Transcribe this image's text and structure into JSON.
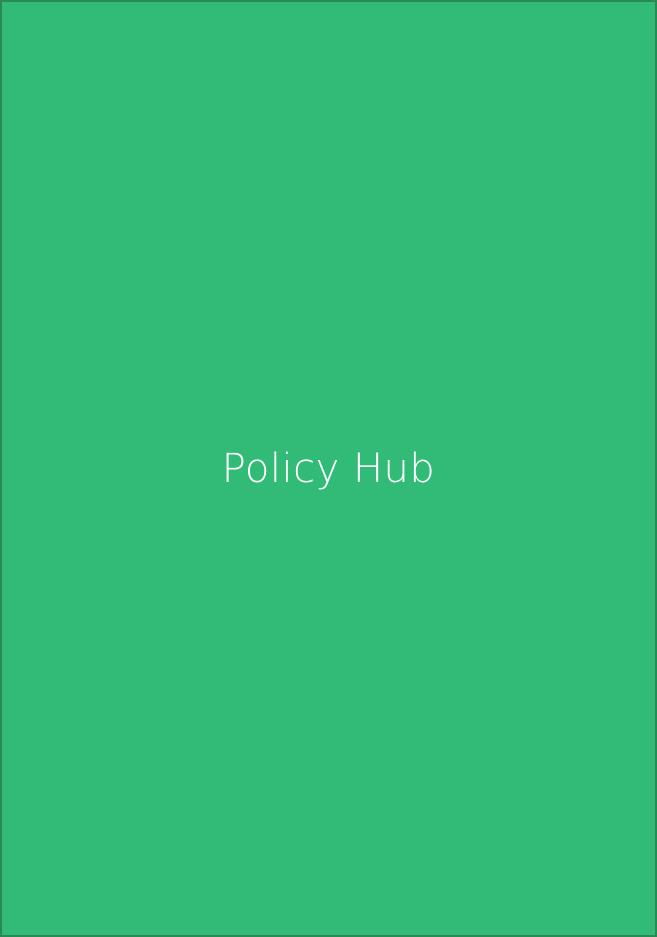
{
  "app": {
    "title": "Policy Hub"
  },
  "colors": {
    "background": "#32bb77",
    "border": "#2a8a55",
    "text": "#ffffff"
  }
}
